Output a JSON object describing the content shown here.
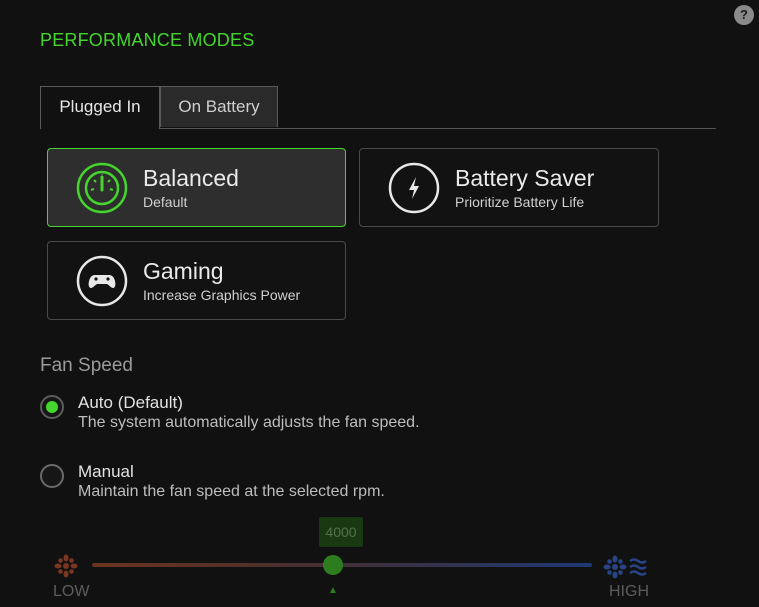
{
  "help": {
    "label": "?"
  },
  "header": {
    "title": "PERFORMANCE MODES"
  },
  "tabs": [
    {
      "label": "Plugged In",
      "active": true
    },
    {
      "label": "On Battery",
      "active": false
    }
  ],
  "modes": [
    {
      "name": "Balanced",
      "description": "Default",
      "icon": "gauge-icon",
      "selected": true
    },
    {
      "name": "Battery Saver",
      "description": "Prioritize Battery Life",
      "icon": "lightning-icon",
      "selected": false
    },
    {
      "name": "Gaming",
      "description": "Increase Graphics Power",
      "icon": "gamepad-icon",
      "selected": false
    }
  ],
  "fan_speed": {
    "label": "Fan Speed",
    "options": [
      {
        "label": "Auto (Default)",
        "description": "The system automatically adjusts the fan speed.",
        "checked": true
      },
      {
        "label": "Manual",
        "description": "Maintain the fan speed at the selected rpm.",
        "checked": false
      }
    ],
    "slider": {
      "value": "4000",
      "low_label": "LOW",
      "high_label": "HIGH",
      "enabled": false,
      "low_icon": "fan-low-icon",
      "high_icon": "fan-high-icon"
    }
  },
  "colors": {
    "accent": "#44d62c",
    "background": "#111111"
  }
}
